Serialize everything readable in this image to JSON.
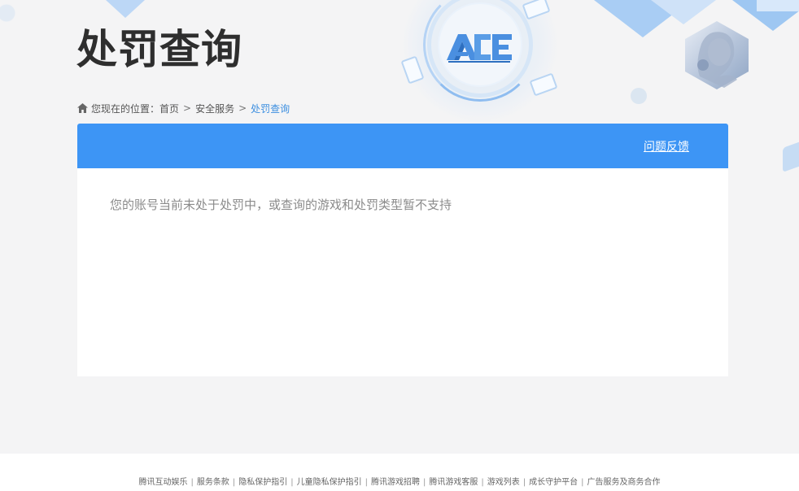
{
  "header": {
    "title": "处罚查询",
    "logo_text": "ACE"
  },
  "breadcrumb": {
    "prefix": "您现在的位置：",
    "items": [
      "首页",
      "安全服务"
    ],
    "current": "处罚查询",
    "separator": ">"
  },
  "card": {
    "feedback_label": "问题反馈",
    "message": "您的账号当前未处于处罚中，或查询的游戏和处罚类型暂不支持"
  },
  "footer": {
    "links": [
      "腾讯互动娱乐",
      "服务条款",
      "隐私保护指引",
      "儿童隐私保护指引",
      "腾讯游戏招聘",
      "腾讯游戏客服",
      "游戏列表",
      "成长守护平台",
      "广告服务及商务合作"
    ],
    "separator": "|"
  },
  "colors": {
    "accent": "#3d95f5",
    "link_current": "#3d8fe0",
    "message_text": "#8b8b8b",
    "background": "#f4f4f5"
  },
  "icons": {
    "home": "home-icon",
    "logo": "ace-logo-icon"
  }
}
